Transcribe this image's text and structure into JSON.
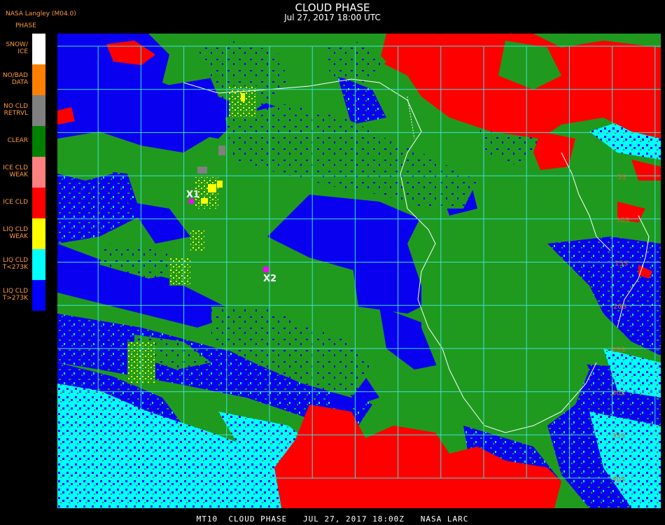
{
  "header": {
    "title": "CLOUD PHASE",
    "datetime": "Jul 27, 2017 18:00 UTC",
    "producer": "NASA Langley (M04.0)",
    "product_label": "PHASE"
  },
  "legend": [
    {
      "label": "SNOW/\nICE",
      "color": "#ffffff"
    },
    {
      "label": "NO/BAD\nDATA",
      "color": "#ff8000"
    },
    {
      "label": "NO CLD\nRETRVL",
      "color": "#808080"
    },
    {
      "label": "CLEAR",
      "color": "#008000"
    },
    {
      "label": "ICE CLD\nWEAK",
      "color": "#ff8080"
    },
    {
      "label": "ICE CLD",
      "color": "#ff0000"
    },
    {
      "label": "LIQ CLD\nWEAK",
      "color": "#ffff00"
    },
    {
      "label": "LIQ CLD\nT<273K",
      "color": "#00ffff"
    },
    {
      "label": "LIQ CLD\nT>273K",
      "color": "#0000ff"
    }
  ],
  "map": {
    "colors": {
      "clear": "#1f9a1f",
      "liq_warm": "#0a00f0",
      "liq_cold": "#00ffff",
      "ice": "#ff0000",
      "liq_weak": "#ffff00",
      "no_retrieval": "#808080",
      "grid": "#40e0d0",
      "coast": "#ffffff"
    },
    "lat_labels": [
      "5S",
      "10S",
      "15S",
      "20S",
      "25S",
      "30S",
      "35S",
      "40S"
    ],
    "markers": [
      {
        "label": "X1"
      },
      {
        "label": "X2"
      }
    ]
  },
  "footer": "MT10  CLOUD PHASE   JUL 27, 2017 18:00Z   NASA LARC"
}
